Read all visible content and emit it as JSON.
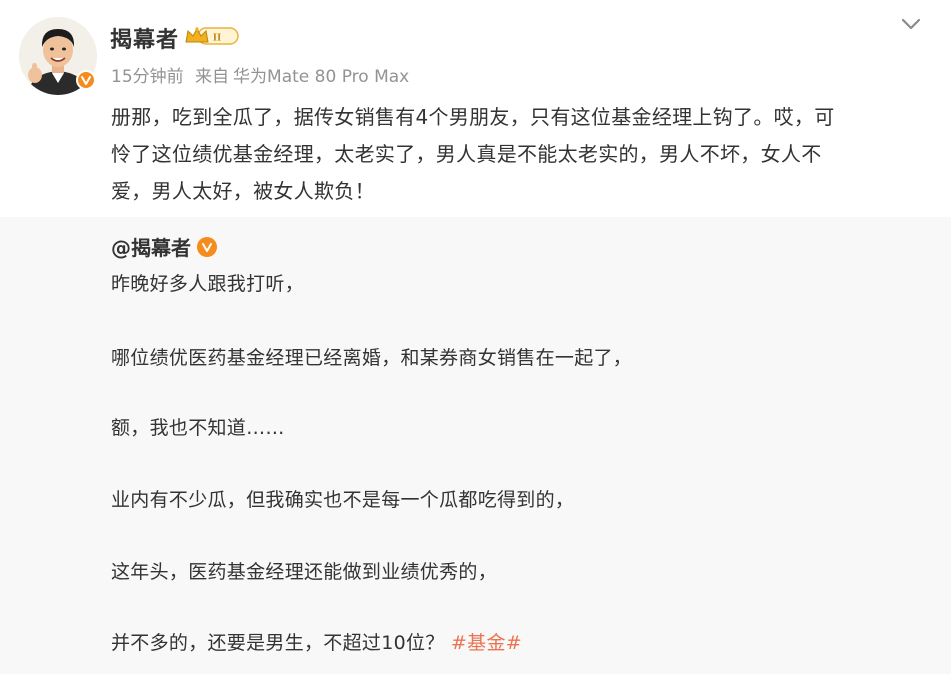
{
  "post": {
    "author": "揭幕者",
    "meta": {
      "time": "15分钟前",
      "from_label": "来自",
      "device": "华为Mate 80 Pro Max"
    },
    "text_lines": [
      "册那，吃到全瓜了，据传女销售有4个男朋友，只有这位基金经理上钩了。哎，可",
      "怜了这位绩优基金经理，太老实了，男人真是不能太老实的，男人不坏，女人不",
      "爱，男人太好，被女人欺负！"
    ]
  },
  "repost": {
    "author": "@揭幕者",
    "lines": [
      "昨晚好多人跟我打听，",
      "哪位绩优医药基金经理已经离婚，和某券商女销售在一起了，",
      "额，我也不知道……",
      "业内有不少瓜，但我确实也不是每一个瓜都吃得到的，",
      "这年头，医药基金经理还能做到业绩优秀的，"
    ],
    "last_line_text": "并不多的，还要是男生，不超过10位？",
    "hashtag": "#基金#"
  },
  "colors": {
    "accent": "#eb7350",
    "verified": "#f78c1e",
    "meta_text": "#939393",
    "repost_bg": "#f8f8f8"
  },
  "icons": {
    "level_badge": "crown-level-badge-icon",
    "verified": "verified-v-icon",
    "more": "chevron-down-icon"
  }
}
